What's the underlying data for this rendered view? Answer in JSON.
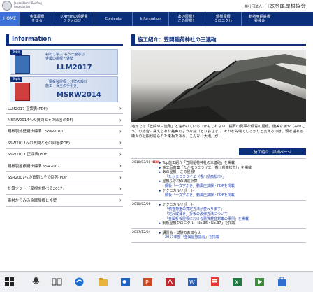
{
  "header": {
    "logo_text": "Japan Metal Roofing Association",
    "org_prefix": "一般社団法人",
    "org_name": "日本金属屋根協会"
  },
  "nav": [
    {
      "label": "HOME"
    },
    {
      "label": "金属屋根\nを知る"
    },
    {
      "label": "0.4mmの超軽量\nテクノロジー"
    },
    {
      "label": "Contents"
    },
    {
      "label": "Information"
    },
    {
      "label": "あの屋根！\nこの屋根！"
    },
    {
      "label": "鋼板屋根\nクロニクル"
    },
    {
      "label": "断熱亜鉛鉄板\n委員会"
    }
  ],
  "left": {
    "section_title": "Information",
    "banners": [
      {
        "topic": "Topic",
        "line1": "初めて学ぶ もう一度学ぶ",
        "line2": "金属の屋根と外壁",
        "big": "LLM2017"
      },
      {
        "topic": "Topic",
        "line1": "「鋼板製屋根・外壁の設計・",
        "line2": "施工・保全の手引き」",
        "big": "MSRW2014"
      }
    ],
    "links": [
      "LLM2017 正誤表(PDF)",
      "MSRW2014への質問とその回答(PDF)",
      "鋼板製外壁構法標準　SSW2011",
      "SSW2011への質問とその回答(PDF)",
      "SSW2011 正誤表(PDF)",
      "鋼板製屋根構法標準 SSR2007",
      "SSR2007への質問とその回答(PDF)",
      "計算ソフト「屋根を調べる2017」",
      "素材からみる金属屋根と外壁"
    ]
  },
  "right": {
    "section_title": "施工紹介：笠間稲荷神社の三連砲",
    "description": "地元では「笠間の三連砲」と言われている（かもしれない）錣葺の見事な緑青の屋根。優美な棟や（みのこう）の総合に揮えられた銘鼻のような庇（とりおさま）。それを先端でしっかりと支えるのは、頭を垂れる職人の社殿が彫られた鬼板である。こんな「大砲」が……",
    "more_label": "施工紹介：詳細ページ",
    "news": [
      {
        "date": "2018/03/08",
        "new": "NEW",
        "items": [
          {
            "text": "Top施工紹介「笠間稲荷神社の三連砲」を掲載",
            "sub": false
          },
          {
            "text": "施工写真集「たかまつミライエ（香川県高松市）」を掲載",
            "sub": false
          },
          {
            "text": "あの屋根！この屋根！",
            "sub": false
          },
          {
            "text": "「たかまつミライエ（香川県高松市）」",
            "sub": true
          },
          {
            "text": "屋根ふき材の構造計算",
            "sub": false
          },
          {
            "text": "鋼板「一文字ぶき」動風圧試験・PDFを掲載",
            "sub": true
          },
          {
            "text": "テクニカルリポート",
            "sub": false
          },
          {
            "text": "鋼板「一文字ぶき」動風圧試験・PDFを掲載",
            "sub": true
          }
        ]
      },
      {
        "date": "2018/02/06",
        "new": "",
        "items": [
          {
            "text": "テクニカルリポート",
            "sub": false
          },
          {
            "text": "「積雪荷重の算定方法が変わります」",
            "sub": true
          },
          {
            "text": "「定尺縦葺き」折板の改修方法について",
            "sub": true
          },
          {
            "text": "「金属折板屋根における悪質雑音対策の事例」を掲載",
            "sub": true
          },
          {
            "text": "鋼板屋根クロニクル「No.36・No.37」を掲載",
            "sub": false
          }
        ]
      },
      {
        "date": "2017/12/04",
        "new": "",
        "items": [
          {
            "text": "講習会・試験のお知らせ",
            "sub": false
          },
          {
            "text": "2017年度「金属屋根講習」を掲載",
            "sub": true
          }
        ]
      }
    ]
  },
  "taskbar": {
    "icons": [
      "windows-start-icon",
      "search-icon",
      "task-view-icon",
      "edge-browser-icon",
      "file-explorer-icon",
      "outlook-icon",
      "powerpoint-icon",
      "acrobat-icon",
      "word-icon",
      "pdf-icon",
      "excel-icon",
      "media-icon",
      "store-icon"
    ]
  },
  "colors": {
    "nav_bg": "#0b2f7a",
    "home_bg": "#3b72d8",
    "accent_red": "#d22"
  }
}
